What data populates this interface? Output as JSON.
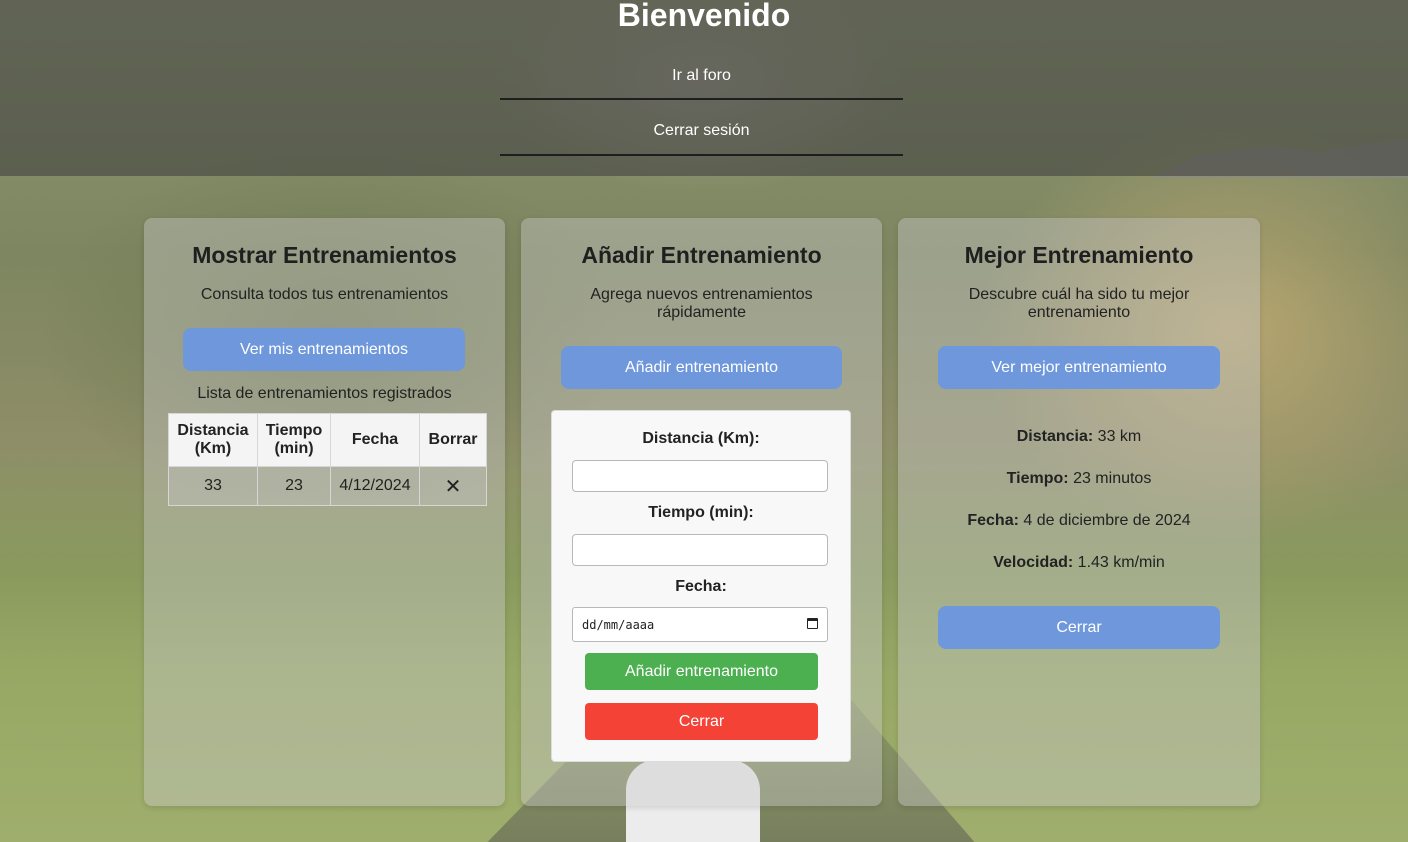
{
  "header": {
    "title": "Bienvenido",
    "nav_forum": "Ir al foro",
    "nav_logout": "Cerrar sesión"
  },
  "show_card": {
    "title": "Mostrar Entrenamientos",
    "description": "Consulta todos tus entrenamientos",
    "button": "Ver mis entrenamientos",
    "list_title": "Lista de entrenamientos registrados",
    "table": {
      "headers": [
        "Distancia (Km)",
        "Tiempo (min)",
        "Fecha",
        "Borrar"
      ],
      "rows": [
        {
          "distance": "33",
          "time": "23",
          "date": "4/12/2024",
          "delete": "✕"
        }
      ]
    }
  },
  "add_card": {
    "title": "Añadir Entrenamiento",
    "description": "Agrega nuevos entrenamientos rápidamente",
    "button": "Añadir entrenamiento",
    "form": {
      "distance_label": "Distancia (Km):",
      "distance_value": "",
      "time_label": "Tiempo (min):",
      "time_value": "",
      "date_label": "Fecha:",
      "date_placeholder": "dd/mm/aaaa",
      "submit": "Añadir entrenamiento",
      "close": "Cerrar"
    }
  },
  "best_card": {
    "title": "Mejor Entrenamiento",
    "description": "Descubre cuál ha sido tu mejor entrenamiento",
    "button": "Ver mejor entrenamiento",
    "distance_label": "Distancia:",
    "distance_value": "33 km",
    "time_label": "Tiempo:",
    "time_value": "23 minutos",
    "date_label": "Fecha:",
    "date_value": "4 de diciembre de 2024",
    "speed_label": "Velocidad:",
    "speed_value": "1.43 km/min",
    "close": "Cerrar"
  },
  "colors": {
    "primary_button": "#6e97dc",
    "submit_button": "#4caf50",
    "close_button": "#f44336"
  },
  "icons": {
    "delete": "close-icon",
    "calendar": "calendar-icon"
  }
}
